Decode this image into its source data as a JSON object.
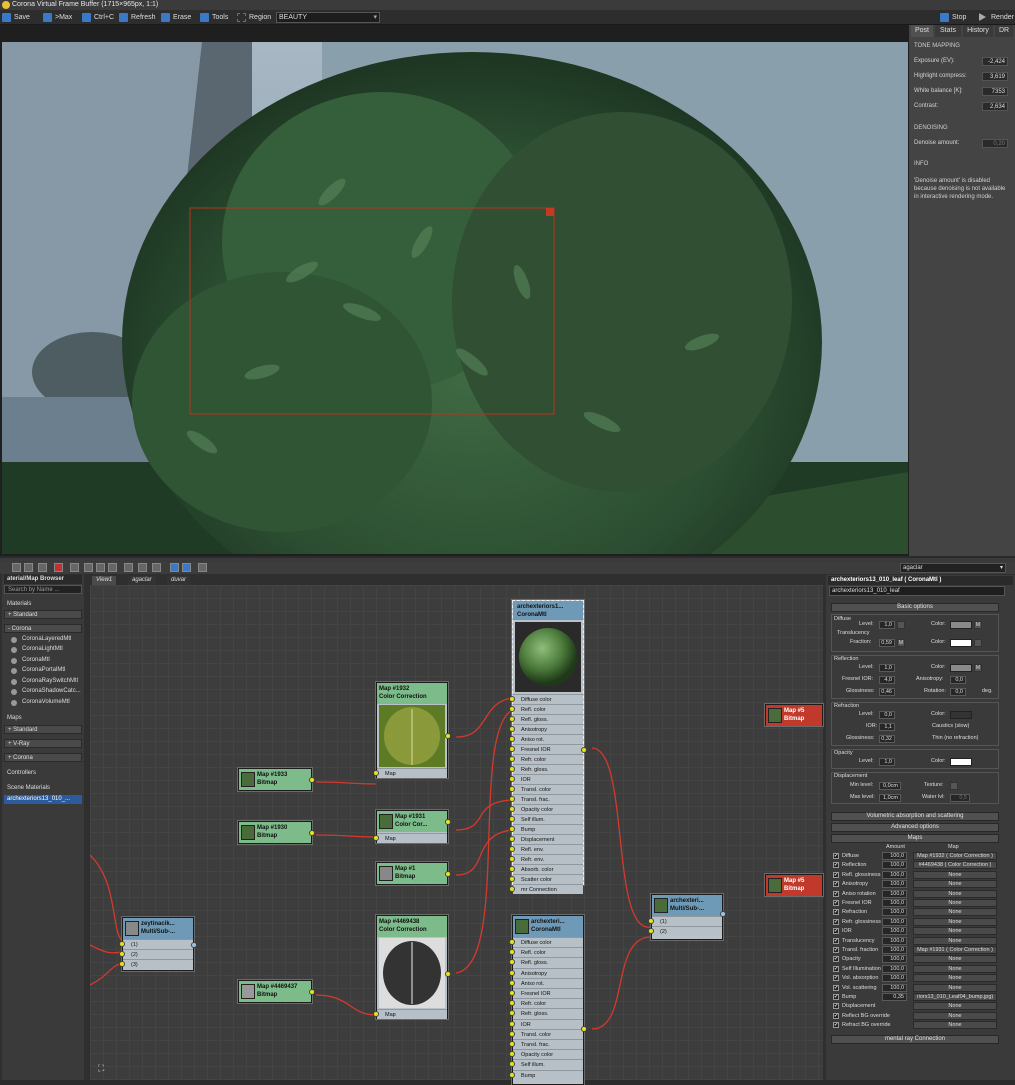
{
  "vfb": {
    "title": "Corona Virtual Frame Buffer (1715×965px, 1:1)",
    "toolbar": {
      "save": "Save",
      "max": ">Max",
      "copy": "Ctrl+C",
      "refresh": "Refresh",
      "erase": "Erase",
      "tools": "Tools",
      "region": "Region",
      "pass": "BEAUTY",
      "stop": "Stop",
      "render": "Render"
    },
    "tabs": [
      "Post",
      "Stats",
      "History",
      "DR"
    ],
    "tone_mapping": {
      "heading": "TONE MAPPING",
      "exposure_label": "Exposure (EV):",
      "exposure_value": "-2,424",
      "highlight_label": "Highlight compress:",
      "highlight_value": "3,619",
      "wb_label": "White balance [K]:",
      "wb_value": "7353",
      "contrast_label": "Contrast:",
      "contrast_value": "2,634"
    },
    "denoising": {
      "heading": "DENOISING",
      "amount_label": "Denoise amount:",
      "amount_value": "0,20"
    },
    "info": {
      "heading": "INFO",
      "text": "'Denoise amount' is disabled because denoising is not available in interactive rendering mode."
    }
  },
  "sme": {
    "view_select": "agaclar",
    "view_tabs": [
      "View1",
      "agaclar",
      "duvar"
    ],
    "browser": {
      "title": "aterial/Map Browser",
      "search_placeholder": "Search by Name ...",
      "materials_label": "Materials",
      "standard_group": "+ Standard",
      "corona_group": "- Corona",
      "corona_items": [
        "CoronaLayeredMtl",
        "CoronaLightMtl",
        "CoronaMtl",
        "CoronaPortalMtl",
        "CoronaRaySwitchMtl",
        "CoronaShadowCatc...",
        "CoronaVolumeMtl"
      ],
      "maps_label": "Maps",
      "maps_standard": "+ Standard",
      "maps_vray": "+ V-Ray",
      "maps_corona": "+ Corona",
      "controllers_label": "Controllers",
      "scene_materials_label": "Scene Materials",
      "scene_item": "archexteriors13_010_..."
    },
    "nodes": {
      "main_mtl": {
        "name": "archexteriors1...",
        "type": "CoronaMtl"
      },
      "main_slots": [
        "Diffuse color",
        "Refl. color",
        "Refl. gloss.",
        "Anisotropy",
        "Aniso rot.",
        "Fresnel IOR",
        "Refr. color",
        "Refr. gloss.",
        "IOR",
        "Transl. color",
        "Transl. frac.",
        "Opacity color",
        "Self illum.",
        "Bump",
        "Displacement",
        "Refl. env.",
        "Refr. env.",
        "Absorb. color",
        "Scatter color",
        "mr Connection"
      ],
      "mtl2": {
        "name": "archexteri...",
        "type": "CoronaMtl"
      },
      "mtl2_slots": [
        "Diffuse color",
        "Refl. color",
        "Refl. gloss.",
        "Anisotropy",
        "Aniso rot.",
        "Fresnel IOR",
        "Refr. color",
        "Refr. gloss.",
        "IOR",
        "Transl. color",
        "Transl. frac.",
        "Opacity color",
        "Self illum.",
        "Bump"
      ],
      "map1932": {
        "name": "Map #1932",
        "type": "Color Correction",
        "slot": "Map"
      },
      "map1933": {
        "name": "Map #1933",
        "type": "Bitmap"
      },
      "map1930": {
        "name": "Map #1930",
        "type": "Bitmap"
      },
      "map1931": {
        "name": "Map #1931",
        "type": "Color Cor...",
        "slot": "Map"
      },
      "map1": {
        "name": "Map #1",
        "type": "Bitmap"
      },
      "map4469438": {
        "name": "Map #4469438",
        "type": "Color Correction",
        "slot": "Map"
      },
      "map4469437": {
        "name": "Map #4469437",
        "type": "Bitmap"
      },
      "multi_left": {
        "name": "zeytinacik...",
        "type": "Multi/Sub-...",
        "slots": [
          "(1)",
          "(2)",
          "(3)"
        ]
      },
      "multi_right": {
        "name": "archexteri...",
        "type": "Multi/Sub-...",
        "slots": [
          "(1)",
          "(2)"
        ]
      },
      "red1": {
        "name": "Map #5",
        "type": "Bitmap"
      },
      "red2": {
        "name": "Map #5",
        "type": "Bitmap"
      }
    },
    "params": {
      "title": "archexteriors13_010_leaf  ( CoronaMtl )",
      "name": "archexteriors13_010_leaf",
      "basic_options": "Basic options",
      "diffuse": "Diffuse",
      "level": "Level:",
      "diffuse_level": "1,0",
      "color": "Color:",
      "translucency": "Translucency",
      "fraction": "Fraction:",
      "fraction_value": "0,59",
      "reflection": "Reflection",
      "refl_level": "1,0",
      "fresnel_ior": "Fresnel IOR:",
      "fresnel_value": "4,0",
      "anisotropy": "Anisotropy:",
      "anisotropy_value": "0,0",
      "glossiness": "Glossiness:",
      "gloss_value": "0,46",
      "rotation": "Rotation:",
      "rotation_value": "0,0",
      "deg": "deg.",
      "refraction": "Refraction",
      "refr_level": "0,0",
      "ior": "IOR:",
      "ior_value": "1,1",
      "caustics": "Caustics (slow)",
      "refr_gloss_value": "0,32",
      "thin": "Thin (no refraction)",
      "opacity": "Opacity",
      "opacity_level": "1,0",
      "displacement": "Displacement",
      "min_level": "Min level:",
      "min_level_value": "0,0cm",
      "texture": "Texture:",
      "max_level": "Max level:",
      "max_level_value": "1,0cm",
      "water_lvl": "Water lvl:",
      "water_lvl_value": "0,5",
      "volumetric": "Volumetric absorption and scattering",
      "advanced": "Advanced options",
      "maps_rollout": "Maps",
      "amount_header": "Amount",
      "map_header": "Map",
      "maps": [
        {
          "label": "Diffuse",
          "amount": "100,0",
          "map": "Map #1932  ( Color Correction )"
        },
        {
          "label": "Reflection",
          "amount": "100,0",
          "map": "#4469438  ( Color Correction )"
        },
        {
          "label": "Refl. glossiness",
          "amount": "100,0",
          "map": "None"
        },
        {
          "label": "Anisotropy",
          "amount": "100,0",
          "map": "None"
        },
        {
          "label": "Aniso rotation",
          "amount": "100,0",
          "map": "None"
        },
        {
          "label": "Fresnel IOR",
          "amount": "100,0",
          "map": "None"
        },
        {
          "label": "Refraction",
          "amount": "100,0",
          "map": "None"
        },
        {
          "label": "Refr. glossiness",
          "amount": "100,0",
          "map": "None"
        },
        {
          "label": "IOR",
          "amount": "100,0",
          "map": "None"
        },
        {
          "label": "Translucency",
          "amount": "100,0",
          "map": "None"
        },
        {
          "label": "Transl. fraction",
          "amount": "100,0",
          "map": "Map #1931  ( Color Correction )"
        },
        {
          "label": "Opacity",
          "amount": "100,0",
          "map": "None"
        },
        {
          "label": "Self Illumination",
          "amount": "100,0",
          "map": "None"
        },
        {
          "label": "Vol. absorption",
          "amount": "100,0",
          "map": "None"
        },
        {
          "label": "Vol. scattering",
          "amount": "100,0",
          "map": "None"
        },
        {
          "label": "Bump",
          "amount": "0,35",
          "map": "riors13_010_Leaf04_bump.jpg)"
        },
        {
          "label": "Displacement",
          "amount": "",
          "map": "None"
        },
        {
          "label": "Reflect BG override",
          "amount": "",
          "map": "None"
        },
        {
          "label": "Refract BG override",
          "amount": "",
          "map": "None"
        }
      ],
      "mr_connection": "mental ray Connection"
    }
  }
}
